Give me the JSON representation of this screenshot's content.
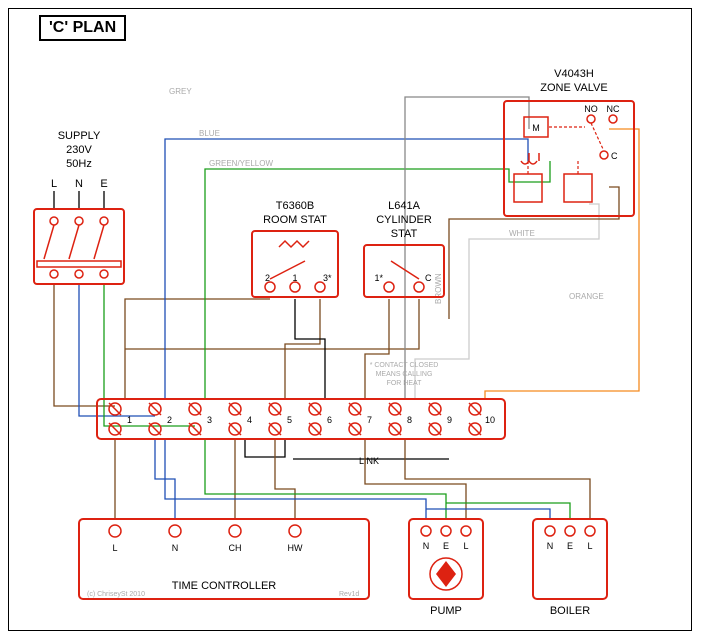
{
  "title": "'C' PLAN",
  "supply": {
    "label": "SUPPLY",
    "voltage": "230V",
    "freq": "50Hz",
    "L": "L",
    "N": "N",
    "E": "E"
  },
  "room_stat": {
    "model": "T6360B",
    "name": "ROOM STAT",
    "t1": "1",
    "t2": "2",
    "t3": "3*"
  },
  "cyl_stat": {
    "model": "L641A",
    "name": "CYLINDER",
    "name2": "STAT",
    "t1": "1*",
    "tC": "C",
    "note1": "* CONTACT CLOSED",
    "note2": "MEANS CALLING",
    "note3": "FOR HEAT"
  },
  "zone_valve": {
    "model": "V4043H",
    "name": "ZONE VALVE",
    "M": "M",
    "NO": "NO",
    "NC": "NC",
    "C": "C"
  },
  "junction": {
    "t1": "1",
    "t2": "2",
    "t3": "3",
    "t4": "4",
    "t5": "5",
    "t6": "6",
    "t7": "7",
    "t8": "8",
    "t9": "9",
    "t10": "10",
    "link": "LINK"
  },
  "time_ctrl": {
    "name": "TIME CONTROLLER",
    "L": "L",
    "N": "N",
    "CH": "CH",
    "HW": "HW"
  },
  "pump": {
    "name": "PUMP",
    "N": "N",
    "E": "E",
    "L": "L"
  },
  "boiler": {
    "name": "BOILER",
    "N": "N",
    "E": "E",
    "L": "L"
  },
  "wires": {
    "grey": "GREY",
    "blue": "BLUE",
    "greenyellow": "GREEN/YELLOW",
    "brown": "BROWN",
    "white": "WHITE",
    "orange": "ORANGE"
  },
  "credits": {
    "copy": "(c) ChriseySt 2010",
    "rev": "Rev1d"
  }
}
